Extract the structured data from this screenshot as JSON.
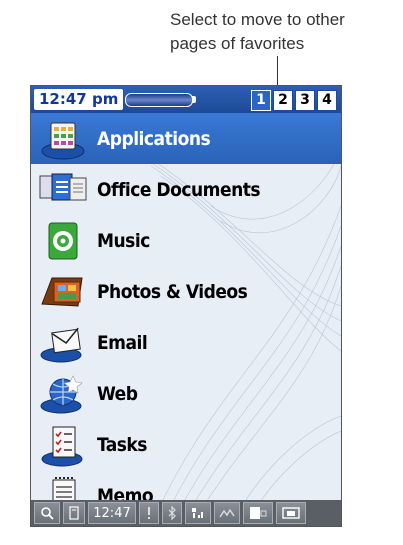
{
  "annotation": {
    "line1": "Select to move to other",
    "line2": "pages of favorites"
  },
  "status": {
    "time": "12:47 pm",
    "pages": [
      "1",
      "2",
      "3",
      "4"
    ],
    "active_page": "1"
  },
  "favorites": [
    {
      "label": "Applications",
      "icon": "applications-icon",
      "selected": true
    },
    {
      "label": "Office Documents",
      "icon": "office-documents-icon",
      "selected": false
    },
    {
      "label": "Music",
      "icon": "music-icon",
      "selected": false
    },
    {
      "label": "Photos & Videos",
      "icon": "photos-videos-icon",
      "selected": false
    },
    {
      "label": "Email",
      "icon": "email-icon",
      "selected": false
    },
    {
      "label": "Web",
      "icon": "web-icon",
      "selected": false
    },
    {
      "label": "Tasks",
      "icon": "tasks-icon",
      "selected": false
    },
    {
      "label": "Memo",
      "icon": "memo-icon",
      "selected": false
    }
  ],
  "taskbar": {
    "time": "12:47",
    "icons": [
      "search-icon",
      "phone-icon",
      "alert-icon",
      "bluetooth-icon",
      "signal-icon",
      "data-icon",
      "device-icon",
      "screen-icon"
    ]
  },
  "colors": {
    "status_bar": "#1d4a98",
    "selection": "#2a62b8",
    "taskbar": "#5a5f66"
  }
}
